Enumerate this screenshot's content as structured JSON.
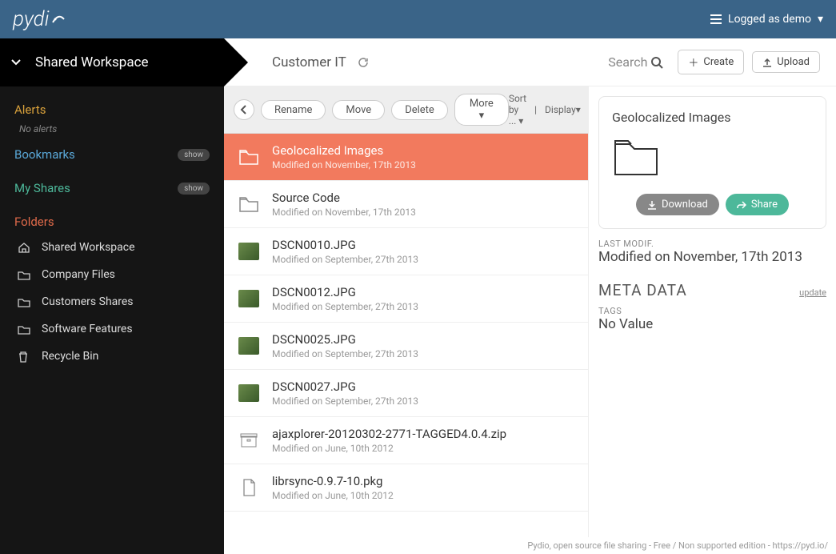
{
  "brand": "pydi",
  "user": {
    "label": "Logged as demo"
  },
  "workspace": {
    "name": "Shared Workspace"
  },
  "breadcrumb": {
    "current": "Customer IT"
  },
  "search": {
    "label": "Search"
  },
  "create_btn": "Create",
  "upload_btn": "Upload",
  "sidebar": {
    "alerts": {
      "title": "Alerts",
      "empty": "No alerts"
    },
    "bookmarks": {
      "title": "Bookmarks",
      "show": "show"
    },
    "myshares": {
      "title": "My Shares",
      "show": "show"
    },
    "folders_title": "Folders",
    "folders": [
      {
        "icon": "home",
        "label": "Shared Workspace"
      },
      {
        "icon": "folder",
        "label": "Company Files"
      },
      {
        "icon": "folder",
        "label": "Customers Shares"
      },
      {
        "icon": "folder",
        "label": "Software Features"
      },
      {
        "icon": "trash",
        "label": "Recycle Bin"
      }
    ]
  },
  "actions": {
    "rename": "Rename",
    "move": "Move",
    "delete": "Delete",
    "more": "More",
    "sort": "Sort by ...",
    "display": "Display"
  },
  "files": [
    {
      "kind": "folder",
      "name": "Geolocalized Images",
      "sub": "Modified on November, 17th 2013",
      "selected": true
    },
    {
      "kind": "folder",
      "name": "Source Code",
      "sub": "Modified on November, 17th 2013"
    },
    {
      "kind": "image",
      "name": "DSCN0010.JPG",
      "sub": "Modified on September, 27th 2013"
    },
    {
      "kind": "image",
      "name": "DSCN0012.JPG",
      "sub": "Modified on September, 27th 2013"
    },
    {
      "kind": "image",
      "name": "DSCN0025.JPG",
      "sub": "Modified on September, 27th 2013"
    },
    {
      "kind": "image",
      "name": "DSCN0027.JPG",
      "sub": "Modified on September, 27th 2013"
    },
    {
      "kind": "archive",
      "name": "ajaxplorer-20120302-2771-TAGGED4.0.4.zip",
      "sub": "Modified on June, 10th 2012"
    },
    {
      "kind": "file",
      "name": "librsync-0.9.7-10.pkg",
      "sub": "Modified on June, 10th 2012"
    }
  ],
  "details": {
    "title": "Geolocalized Images",
    "download": "Download",
    "share": "Share",
    "lastmodif_label": "LAST MODIF.",
    "lastmodif_value": "Modified on November, 17th 2013",
    "metadata_title": "META DATA",
    "update": "update",
    "tags_label": "TAGS",
    "tags_value": "No Value"
  },
  "footer": "Pydio, open source file sharing - Free / Non supported edition - https://pyd.io/"
}
